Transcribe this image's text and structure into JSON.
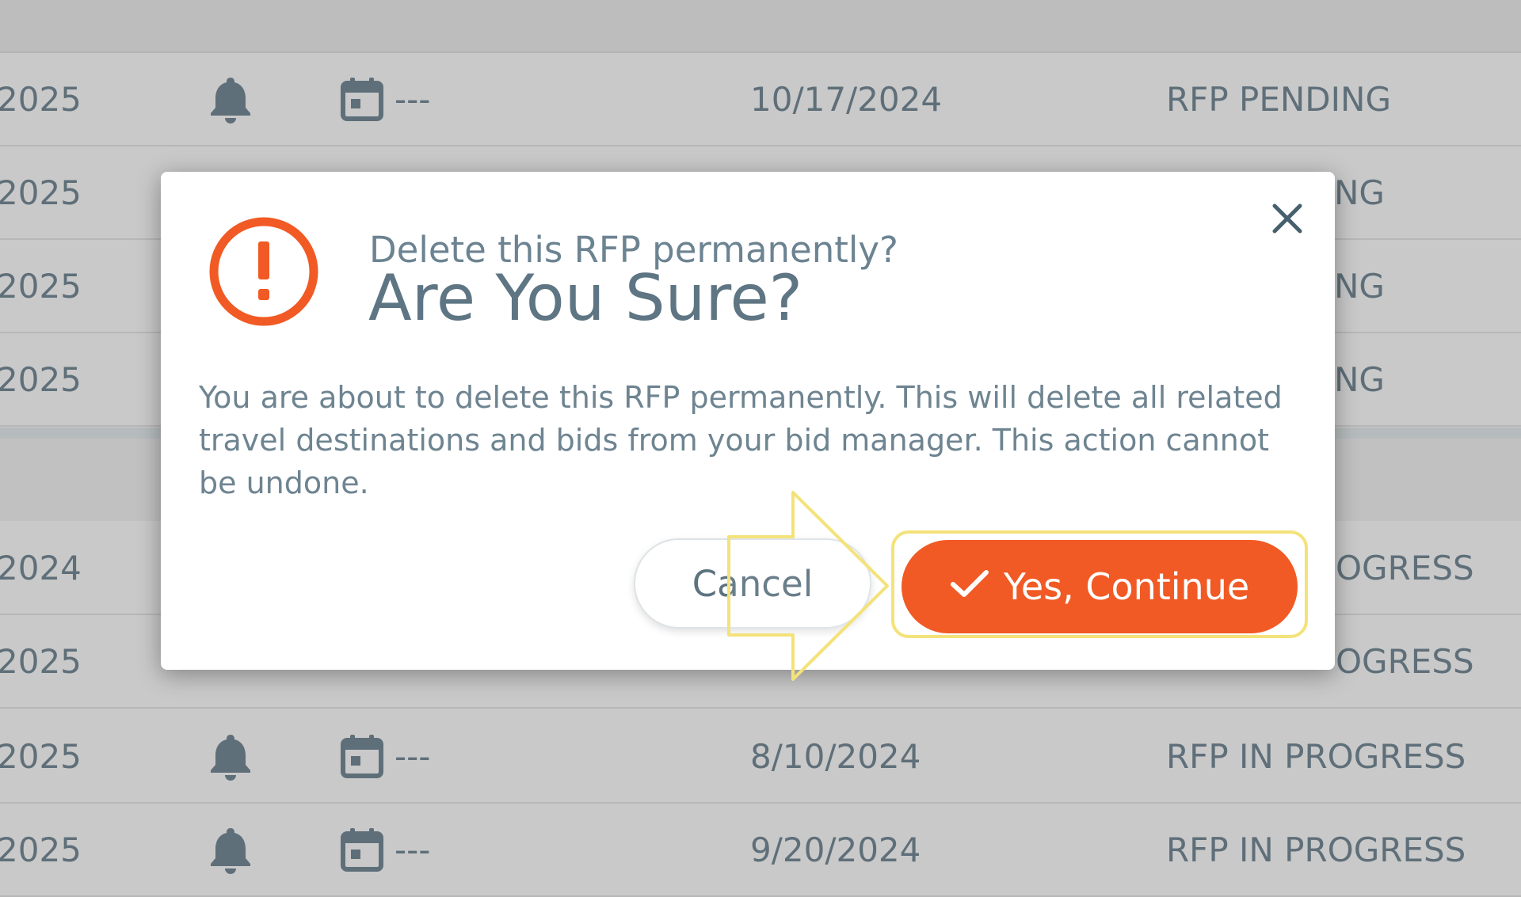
{
  "table": {
    "rows": [
      {
        "year": "2025",
        "calendar": "---",
        "date": "10/17/2024",
        "status": "RFP PENDING"
      },
      {
        "year": "2025",
        "calendar": "",
        "date": "",
        "status": "NG"
      },
      {
        "year": "2025",
        "calendar": "",
        "date": "",
        "status": "NG"
      },
      {
        "year": "2025",
        "calendar": "",
        "date": "",
        "status": "NG"
      },
      {
        "year": "2024",
        "calendar": "",
        "date": "",
        "status": "OGRESS"
      },
      {
        "year": "2025",
        "calendar": "",
        "date": "",
        "status": "OGRESS"
      },
      {
        "year": "2025",
        "calendar": "---",
        "date": "8/10/2024",
        "status": "RFP IN PROGRESS"
      },
      {
        "year": "2025",
        "calendar": "---",
        "date": "9/20/2024",
        "status": "RFP IN PROGRESS"
      }
    ]
  },
  "modal": {
    "subtitle": "Delete this RFP permanently?",
    "title": "Are You Sure?",
    "message": "You are about to delete this RFP permanently. This will delete all related travel destinations and bids from your bid manager. This action cannot be undone.",
    "cancel_label": "Cancel",
    "continue_label": "Yes, Continue",
    "close_icon": "close-icon",
    "alert_icon": "exclamation-circle-icon",
    "check_icon": "check-icon"
  },
  "colors": {
    "accent": "#f15a24",
    "highlight": "#f4e27a",
    "text": "#5d7380"
  }
}
